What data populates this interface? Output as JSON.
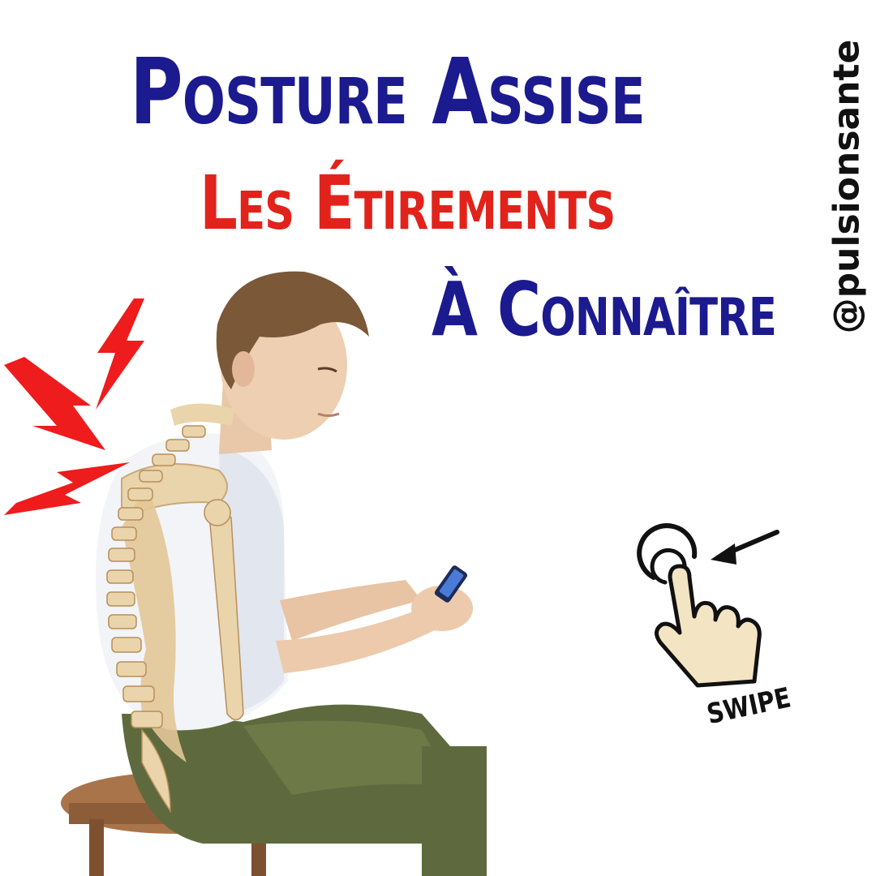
{
  "header": {
    "line1": "Posture  Assise",
    "line2": "Les Étirements",
    "line3": "À Connaître"
  },
  "handle": "@pulsionsante",
  "swipe": {
    "label": "SWIPE",
    "icon": "tap-hand-icon"
  },
  "illustration": {
    "icon": "seated-man-spine-pain-illustration",
    "pain_icon": "lightning-bolt-icon"
  },
  "colors": {
    "title_blue": "#1b1a8f",
    "title_red": "#e1231b",
    "pain_red": "#ee1c1c",
    "skin_hand": "#f3e4c4",
    "shirt": "#f2f4f8",
    "pants": "#5e6a3e",
    "bone": "#ead4ab",
    "hair": "#7a5838",
    "stool": "#a9744a"
  }
}
